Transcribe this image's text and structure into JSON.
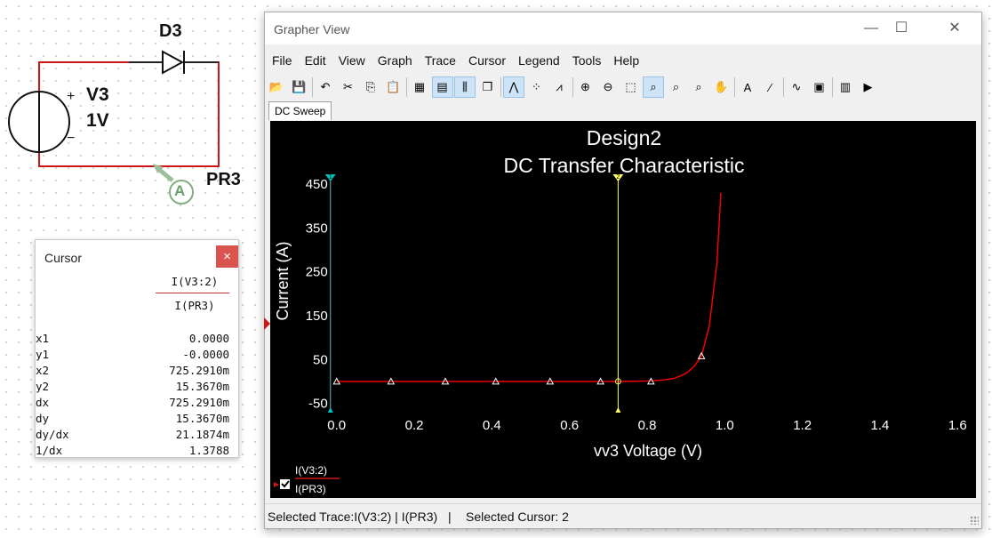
{
  "schematic": {
    "diode_label": "D3",
    "source_name": "V3",
    "source_value": "1V",
    "probe_letter": "A",
    "probe_name": "PR3",
    "plus_sign": "+",
    "minus_sign": "−"
  },
  "cursor_panel": {
    "title": "Cursor",
    "close_symbol": "×",
    "col_header": "I(V3:2)",
    "col_subheader": "I(PR3)",
    "rows": [
      {
        "label": "x1",
        "value": "0.0000"
      },
      {
        "label": "y1",
        "value": "-0.0000"
      },
      {
        "label": "x2",
        "value": "725.2910m"
      },
      {
        "label": "y2",
        "value": "15.3670m"
      },
      {
        "label": "dx",
        "value": "725.2910m"
      },
      {
        "label": "dy",
        "value": "15.3670m"
      },
      {
        "label": "dy/dx",
        "value": "21.1874m"
      },
      {
        "label": "1/dx",
        "value": "1.3788"
      }
    ]
  },
  "grapher": {
    "window_title": "Grapher View",
    "minimize_symbol": "—",
    "maximize_symbol": "☐",
    "close_symbol": "✕",
    "menu": [
      "File",
      "Edit",
      "View",
      "Graph",
      "Trace",
      "Cursor",
      "Legend",
      "Tools",
      "Help"
    ],
    "toolbar_icons": [
      {
        "name": "open-icon",
        "glyph": "📂",
        "active": false
      },
      {
        "name": "save-icon",
        "glyph": "💾",
        "active": false
      },
      {
        "name": "sep"
      },
      {
        "name": "undo-icon",
        "glyph": "↶",
        "active": false
      },
      {
        "name": "cut-icon",
        "glyph": "✂",
        "active": false
      },
      {
        "name": "copy-icon",
        "glyph": "⎘",
        "active": false
      },
      {
        "name": "paste-icon",
        "glyph": "📋",
        "active": false
      },
      {
        "name": "sep"
      },
      {
        "name": "grid-icon",
        "glyph": "▦",
        "active": false
      },
      {
        "name": "legend-icon",
        "glyph": "▤",
        "active": true
      },
      {
        "name": "cursors-icon",
        "glyph": "⫼",
        "active": true
      },
      {
        "name": "overlay-icon",
        "glyph": "❐",
        "active": false
      },
      {
        "name": "sep"
      },
      {
        "name": "trace-line-icon",
        "glyph": "⋀",
        "active": true
      },
      {
        "name": "trace-points-icon",
        "glyph": "⁘",
        "active": false
      },
      {
        "name": "trace-linepoints-icon",
        "glyph": "⩘",
        "active": false
      },
      {
        "name": "sep"
      },
      {
        "name": "zoom-in-icon",
        "glyph": "⊕",
        "active": false
      },
      {
        "name": "zoom-out-icon",
        "glyph": "⊖",
        "active": false
      },
      {
        "name": "zoom-area-icon",
        "glyph": "⬚",
        "active": false
      },
      {
        "name": "zoom-full-icon",
        "glyph": "⌕",
        "active": true
      },
      {
        "name": "zoom-x-icon",
        "glyph": "⌕",
        "active": false
      },
      {
        "name": "zoom-y-icon",
        "glyph": "⌕",
        "active": false
      },
      {
        "name": "pan-icon",
        "glyph": "✋",
        "active": false
      },
      {
        "name": "sep"
      },
      {
        "name": "text-icon",
        "glyph": "A",
        "active": false
      },
      {
        "name": "label-icon",
        "glyph": "⁄",
        "active": false
      },
      {
        "name": "sep"
      },
      {
        "name": "add-trace-icon",
        "glyph": "∿",
        "active": false
      },
      {
        "name": "properties-icon",
        "glyph": "▣",
        "active": false
      },
      {
        "name": "sep"
      },
      {
        "name": "export-icon",
        "glyph": "▥",
        "active": false
      },
      {
        "name": "export-excel-icon",
        "glyph": "▶",
        "active": false
      }
    ],
    "tab_label": "DC Sweep",
    "status_trace": "Selected Trace:I(V3:2) | I(PR3)",
    "status_separator": "|",
    "status_cursor": "Selected Cursor: 2",
    "legend": {
      "line1": "I(V3:2)",
      "line2": "I(PR3)"
    },
    "colors": {
      "trace": "#ff0000",
      "cursor1": "#00c0c0",
      "cursor2": "#ffff66",
      "plot_bg": "#000000",
      "axis_text": "#ffffff"
    }
  },
  "chart_data": {
    "type": "line",
    "title": "Design2",
    "subtitle": "DC Transfer Characteristic",
    "xlabel": "vv3 Voltage (V)",
    "ylabel": "Current (A)",
    "xlim": [
      -0.02,
      1.62
    ],
    "ylim": [
      -65,
      460
    ],
    "xticks": [
      "0.0",
      "0.2",
      "0.4",
      "0.6",
      "0.8",
      "1.0",
      "1.2",
      "1.4",
      "1.6"
    ],
    "xtick_values": [
      0.0,
      0.2,
      0.4,
      0.6,
      0.8,
      1.0,
      1.2,
      1.4,
      1.6
    ],
    "yticks": [
      "450",
      "350",
      "250",
      "150",
      "50",
      "-50"
    ],
    "ytick_values": [
      450,
      350,
      250,
      150,
      50,
      -50
    ],
    "series": [
      {
        "name": "I(V3:2)",
        "x": [
          0.0,
          0.1,
          0.2,
          0.3,
          0.4,
          0.5,
          0.6,
          0.7,
          0.75,
          0.8,
          0.84,
          0.87,
          0.9,
          0.92,
          0.94,
          0.96,
          0.98,
          0.99
        ],
        "y": [
          0,
          0,
          0,
          0,
          0,
          0,
          0,
          0,
          0.1,
          1,
          3,
          7,
          18,
          33,
          58,
          125,
          270,
          430
        ]
      }
    ],
    "markers_x": [
      0.0,
      0.14,
      0.28,
      0.41,
      0.55,
      0.68,
      0.81,
      0.94
    ],
    "markers_y": [
      0,
      0,
      0,
      0,
      0,
      0,
      0,
      58
    ],
    "cursors": [
      {
        "label": "1",
        "x": 0.0,
        "y": 0.0
      },
      {
        "label": "2",
        "x": 0.7253,
        "y": 0.015367
      }
    ]
  }
}
